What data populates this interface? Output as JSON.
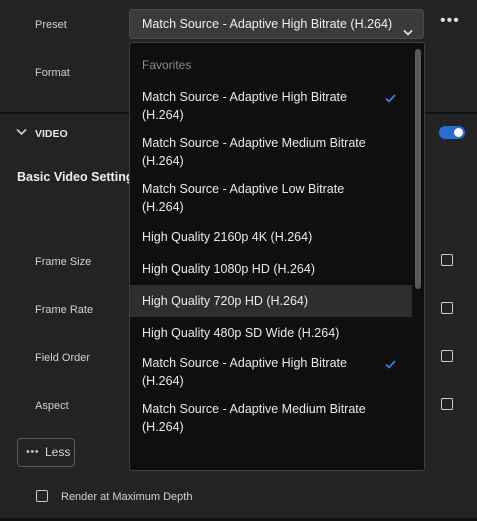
{
  "preset": {
    "label": "Preset",
    "value": "Match Source - Adaptive High Bitrate (H.264)"
  },
  "format": {
    "label": "Format"
  },
  "video": {
    "section_label": "VIDEO",
    "enabled": true
  },
  "basic_video_settings": "Basic Video Settings",
  "settings": {
    "frame_size": "Frame Size",
    "frame_rate": "Frame Rate",
    "field_order": "Field Order",
    "aspect": "Aspect"
  },
  "less_button": "Less",
  "render_max_depth": {
    "label": "Render at Maximum Depth",
    "checked": false
  },
  "dropdown": {
    "section": "Favorites",
    "items": [
      {
        "label": "Match Source - Adaptive High Bitrate (H.264)",
        "checked": true
      },
      {
        "label": "Match Source - Adaptive Medium Bitrate (H.264)",
        "checked": false
      },
      {
        "label": "Match Source - Adaptive Low Bitrate (H.264)",
        "checked": false
      },
      {
        "label": "High Quality 2160p 4K (H.264)",
        "checked": false
      },
      {
        "label": "High Quality 1080p HD (H.264)",
        "checked": false
      },
      {
        "label": "High Quality 720p HD (H.264)",
        "checked": false,
        "hovered": true
      },
      {
        "label": "High Quality 480p SD Wide (H.264)",
        "checked": false
      },
      {
        "label": "Match Source - Adaptive High Bitrate (H.264)",
        "checked": true
      },
      {
        "label": "Match Source - Adaptive Medium Bitrate (H.264)",
        "checked": false
      }
    ]
  },
  "colors": {
    "accent": "#2c6bd6",
    "background": "#232323",
    "dropdown_bg": "#0f0f0f"
  }
}
